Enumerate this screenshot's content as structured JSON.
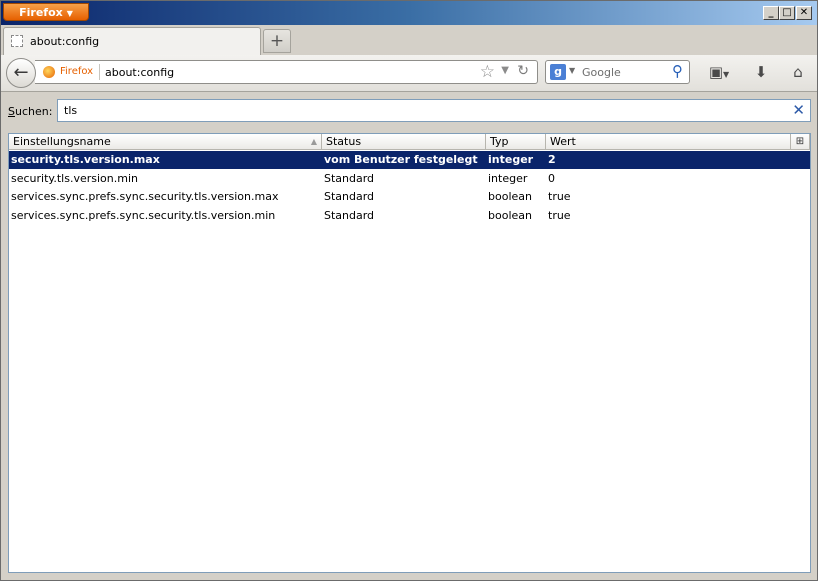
{
  "window": {
    "menu_button_label": "Firefox",
    "minimize_glyph": "_",
    "maximize_glyph": "□",
    "close_glyph": "✕"
  },
  "tabs": [
    {
      "label": "about:config",
      "icon": "blank-page-icon"
    }
  ],
  "new_tab_glyph": "+",
  "navbar": {
    "identity_label": "Firefox",
    "url": "about:config",
    "search_placeholder": "Google",
    "search_engine_icon": "google-g-icon"
  },
  "config": {
    "search_label_underlined": "S",
    "search_label_rest": "uchen:",
    "search_value": "tls",
    "columns": [
      "Einstellungsname",
      "Status",
      "Typ",
      "Wert"
    ],
    "rows": [
      {
        "name": "security.tls.version.max",
        "status": "vom Benutzer festgelegt",
        "type": "integer",
        "value": "2",
        "selected": true
      },
      {
        "name": "security.tls.version.min",
        "status": "Standard",
        "type": "integer",
        "value": "0",
        "selected": false
      },
      {
        "name": "services.sync.prefs.sync.security.tls.version.max",
        "status": "Standard",
        "type": "boolean",
        "value": "true",
        "selected": false
      },
      {
        "name": "services.sync.prefs.sync.security.tls.version.min",
        "status": "Standard",
        "type": "boolean",
        "value": "true",
        "selected": false
      }
    ]
  },
  "colors": {
    "selection": "#0a246a",
    "firefox_orange": "#e66000"
  }
}
